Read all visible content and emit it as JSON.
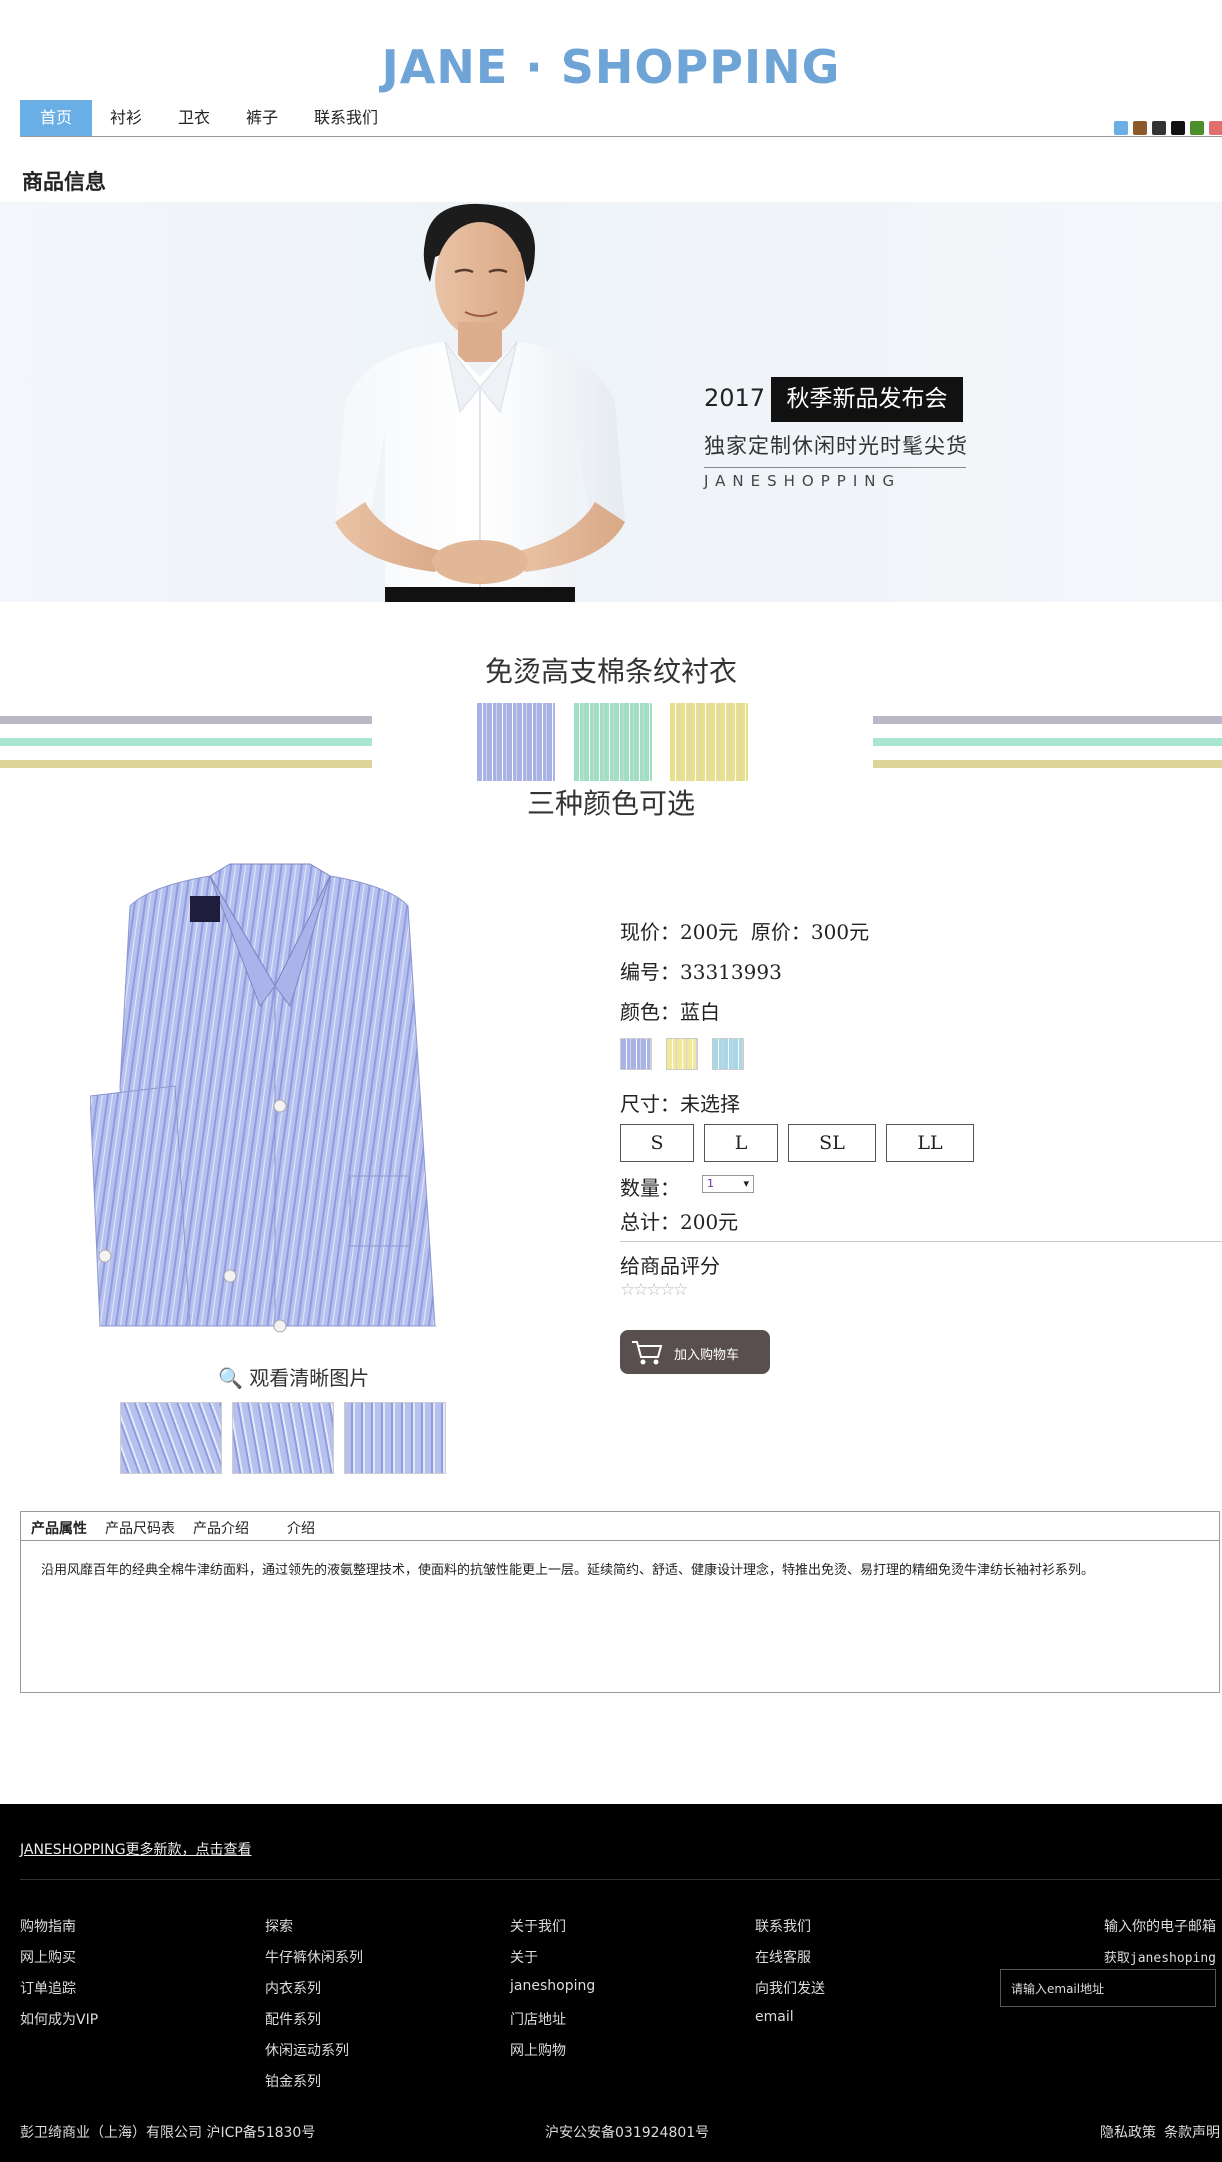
{
  "header": {
    "logo": "JANE · SHOPPING",
    "nav": [
      "首页",
      "衬衫",
      "卫衣",
      "裤子",
      "联系我们"
    ],
    "theme_swatches": [
      "#6aaee6",
      "#8b5a2b",
      "#333333",
      "#111111",
      "#4a8f2a",
      "#e07070"
    ]
  },
  "section_title": "商品信息",
  "banner": {
    "year": "2017",
    "tag": "秋季新品发布会",
    "subtitle": "独家定制休闲时光时髦尖货",
    "brand": "JANESHOPPING",
    "active_slide": 2,
    "slide_count": 5
  },
  "intro": {
    "title": "免烫高支棉条纹衬衣",
    "subtitle": "三种颜色可选",
    "fabric_colors": [
      "#a8b2e6",
      "#9fe0c2",
      "#e8e08a"
    ],
    "stripe_colors": [
      "#b9b9c6",
      "#a9e6cf",
      "#ddd49a"
    ]
  },
  "product": {
    "zoom_label": "观看清晰图片",
    "price_label": "现价：",
    "price": "200元",
    "orig_price_label": "原价：",
    "orig_price": "300元",
    "sku_label": "编号：",
    "sku": "33313993",
    "color_label": "颜色：",
    "color": "蓝白",
    "color_options": [
      "#a8b2e6",
      "#f2e89a",
      "#a8d8e8"
    ],
    "size_label": "尺寸：",
    "size_value": "未选择",
    "sizes": [
      "S",
      "L",
      "SL",
      "LL"
    ],
    "qty_label": "数量：",
    "qty": "1",
    "total_label": "总计：",
    "total": "200元",
    "rate_label": "给商品评分",
    "rating": 0,
    "rating_max": 5,
    "cart_label": "加入购物车"
  },
  "tabs": {
    "items": [
      "产品属性",
      "产品尺码表",
      "产品介绍",
      "介绍"
    ],
    "description": "沿用风靡百年的经典全棉牛津纺面料，通过领先的液氨整理技术，使面料的抗皱性能更上一层。延续简约、舒适、健康设计理念，特推出免烫、易打理的精细免烫牛津纺长袖衬衫系列。"
  },
  "footer": {
    "top_link": "JANESHOPPING更多新款，点击查看",
    "columns": [
      [
        "购物指南",
        "网上购买",
        "订单追踪",
        "如何成为VIP"
      ],
      [
        "探索",
        "牛仔裤休闲系列",
        "内衣系列",
        "配件系列",
        "休闲运动系列",
        "铂金系列"
      ],
      [
        "关于我们",
        "关于",
        "janeshoping",
        "门店地址",
        "网上购物"
      ],
      [
        "联系我们",
        "在线客服",
        "向我们发送",
        "email"
      ]
    ],
    "subscribe_title": "输入你的电子邮箱",
    "subscribe_sub": "获取janeshoping",
    "subscribe_placeholder": "请输入email地址",
    "company": "彭卫绮商业（上海）有限公司 沪ICP备51830号",
    "police": "沪安公安备031924801号",
    "privacy": "隐私政策",
    "terms": "条款声明"
  }
}
